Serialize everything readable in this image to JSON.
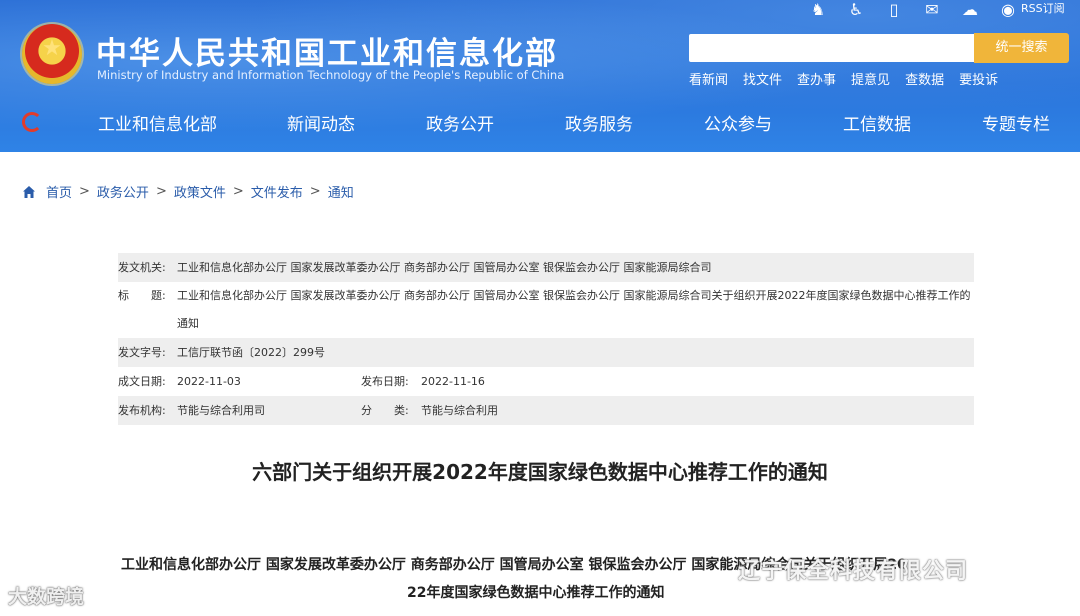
{
  "header": {
    "title": "中华人民共和国工业和信息化部",
    "subtitle": "Ministry of Industry and Information Technology of the People's Republic of China",
    "top_icons": [
      "robot-icon",
      "accessibility-icon",
      "mobile-icon",
      "mail-icon",
      "wechat-icon",
      "weibo-icon"
    ],
    "rss": "RSS订阅",
    "search_placeholder": "",
    "search_button": "统一搜索",
    "quick_links": [
      "看新闻",
      "找文件",
      "查办事",
      "提意见",
      "查数据",
      "要投诉"
    ],
    "colors": {
      "header_blue": "#2a74db",
      "search_button": "#f0b53a"
    }
  },
  "nav": {
    "items": [
      "工业和信息化部",
      "新闻动态",
      "政务公开",
      "政务服务",
      "公众参与",
      "工信数据",
      "专题专栏"
    ]
  },
  "breadcrumb": [
    "首页",
    "政务公开",
    "政策文件",
    "文件发布",
    "通知"
  ],
  "meta": {
    "issuer_label": "发文机关:",
    "issuer": "工业和信息化部办公厅 国家发展改革委办公厅 商务部办公厅 国管局办公室 银保监会办公厅 国家能源局综合司",
    "title_label": "标　　题:",
    "title_value": "工业和信息化部办公厅 国家发展改革委办公厅 商务部办公厅 国管局办公室 银保监会办公厅 国家能源局综合司关于组织开展2022年度国家绿色数据中心推荐工作的通知",
    "doc_no_label": "发文字号:",
    "doc_no": "工信厅联节函〔2022〕299号",
    "created_label": "成文日期:",
    "created": "2022-11-03",
    "published_label": "发布日期:",
    "published": "2022-11-16",
    "agency_label": "发布机构:",
    "agency": "节能与综合利用司",
    "category_label": "分　　类:",
    "category": "节能与综合利用"
  },
  "article": {
    "title": "六部门关于组织开展2022年度国家绿色数据中心推荐工作的通知",
    "line1": "工业和信息化部办公厅 国家发展改革委办公厅 商务部办公厅 国管局办公室 银保监会办公厅 国家能源局综合司关于组织开展20",
    "line2": "22年度国家绿色数据中心推荐工作的通知"
  },
  "watermarks": {
    "left": "大数跨境",
    "right": "辽宁保全科技有限公司"
  }
}
